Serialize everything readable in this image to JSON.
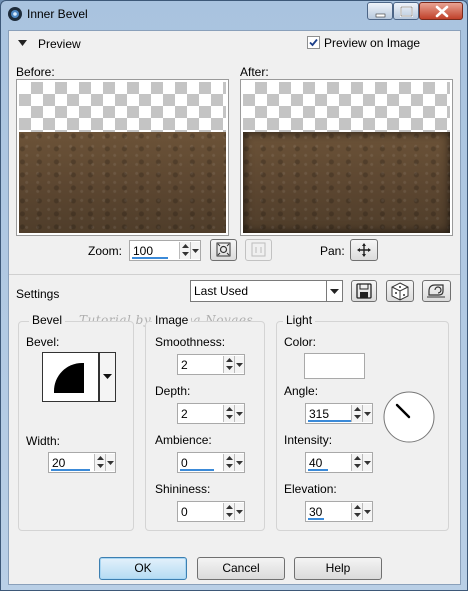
{
  "window": {
    "title": "Inner Bevel"
  },
  "preview_section": {
    "header_label": "Preview",
    "preview_on_image_label": "Preview on Image",
    "preview_on_image_checked": true,
    "before_label": "Before:",
    "after_label": "After:",
    "zoom_label": "Zoom:",
    "zoom_value": "100",
    "pan_label": "Pan:"
  },
  "settings": {
    "label": "Settings",
    "preset_value": "Last Used"
  },
  "watermark": "Tutorial by Regina Novaes",
  "bevel_group": {
    "title": "Bevel",
    "bevel_label": "Bevel:",
    "width_label": "Width:",
    "width_value": "20",
    "width_fraction": 0.2
  },
  "image_group": {
    "title": "Image",
    "smoothness_label": "Smoothness:",
    "smoothness_value": "2",
    "depth_label": "Depth:",
    "depth_value": "2",
    "ambience_label": "Ambience:",
    "ambience_value": "0",
    "shininess_label": "Shininess:",
    "shininess_value": "0"
  },
  "light_group": {
    "title": "Light",
    "color_label": "Color:",
    "color_value": "#ffffff",
    "angle_label": "Angle:",
    "angle_value": "315",
    "intensity_label": "Intensity:",
    "intensity_value": "40",
    "elevation_label": "Elevation:",
    "elevation_value": "30"
  },
  "buttons": {
    "ok": "OK",
    "cancel": "Cancel",
    "help": "Help"
  },
  "colors": {
    "spin_bar": "#3b8ad8",
    "texture_brown": "#5d4731",
    "title_bar": "#a9c3df"
  }
}
